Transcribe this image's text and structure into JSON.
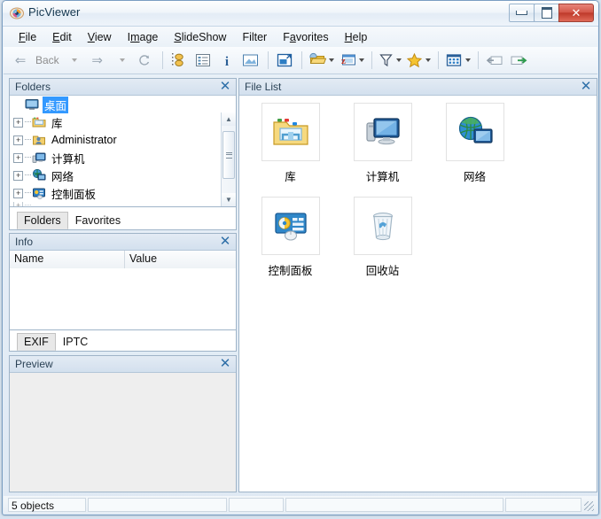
{
  "window": {
    "title": "PicViewer",
    "app_icon": "eye-icon",
    "buttons": {
      "minimize": "minimize-icon",
      "maximize": "maximize-icon",
      "close": "✕"
    }
  },
  "menu": {
    "items": [
      {
        "label": "File",
        "accel": "F"
      },
      {
        "label": "Edit",
        "accel": "E"
      },
      {
        "label": "View",
        "accel": "V"
      },
      {
        "label": "Image",
        "accel": "I"
      },
      {
        "label": "SlideShow",
        "accel": "S"
      },
      {
        "label": "Filter",
        "accel": "F"
      },
      {
        "label": "Favorites",
        "accel": "a"
      },
      {
        "label": "Help",
        "accel": "H"
      }
    ]
  },
  "toolbar": {
    "back_label": "Back",
    "items": [
      {
        "name": "back-button",
        "icon": "arrow-left-icon"
      },
      {
        "name": "back-dropdown",
        "icon": "chevron-down-icon"
      },
      {
        "name": "forward-button",
        "icon": "arrow-right-icon"
      },
      {
        "name": "forward-dropdown",
        "icon": "chevron-down-icon"
      },
      {
        "name": "refresh-button",
        "icon": "refresh-icon"
      },
      {
        "name": "thumbnails-view-button",
        "icon": "thumbnails-icon"
      },
      {
        "name": "details-view-button",
        "icon": "list-icon"
      },
      {
        "name": "info-button",
        "icon": "info-icon"
      },
      {
        "name": "preview-button",
        "icon": "preview-icon"
      },
      {
        "name": "fullscreen-button",
        "icon": "fullscreen-icon"
      },
      {
        "name": "open-folder-button",
        "icon": "folder-icon"
      },
      {
        "name": "slideshow-button",
        "icon": "slideshow-icon"
      },
      {
        "name": "filter-button",
        "icon": "funnel-icon"
      },
      {
        "name": "favorites-button",
        "icon": "star-icon"
      },
      {
        "name": "view-mode-button",
        "icon": "grid-icon"
      },
      {
        "name": "import-button",
        "icon": "import-arrow-icon"
      },
      {
        "name": "export-button",
        "icon": "export-arrow-icon"
      }
    ]
  },
  "folders_panel": {
    "title": "Folders",
    "close": "✕",
    "tree": [
      {
        "label": "桌面",
        "icon": "desktop-icon",
        "expandable": false,
        "selected": true
      },
      {
        "label": "库",
        "icon": "library-icon",
        "expandable": true,
        "selected": false
      },
      {
        "label": "Administrator",
        "icon": "user-icon",
        "expandable": true,
        "selected": false
      },
      {
        "label": "计算机",
        "icon": "computer-icon",
        "expandable": true,
        "selected": false
      },
      {
        "label": "网络",
        "icon": "network-icon",
        "expandable": true,
        "selected": false
      },
      {
        "label": "控制面板",
        "icon": "control-panel-icon",
        "expandable": true,
        "selected": false
      }
    ],
    "expander_plus": "+",
    "tabs": [
      {
        "label": "Folders",
        "active": true
      },
      {
        "label": "Favorites",
        "active": false
      }
    ]
  },
  "info_panel": {
    "title": "Info",
    "close": "✕",
    "columns": [
      "Name",
      "Value"
    ],
    "rows": [],
    "tabs": [
      {
        "label": "EXIF",
        "active": true
      },
      {
        "label": "IPTC",
        "active": false
      }
    ]
  },
  "preview_panel": {
    "title": "Preview",
    "close": "✕"
  },
  "file_list": {
    "title": "File List",
    "close": "✕",
    "items": [
      {
        "name": "库",
        "icon": "library-folder-icon"
      },
      {
        "name": "计算机",
        "icon": "computer-icon"
      },
      {
        "name": "网络",
        "icon": "network-globe-icon"
      },
      {
        "name": "控制面板",
        "icon": "control-panel-icon"
      },
      {
        "name": "回收站",
        "icon": "recycle-bin-icon"
      }
    ]
  },
  "status_bar": {
    "cells": [
      "5 objects",
      "",
      "",
      "",
      ""
    ],
    "grip": "resize-grip-icon"
  },
  "colors": {
    "accent": "#3399ff",
    "panel_caption": "#d3e0ee",
    "frame_border": "#7a9ec2",
    "close_button": "#bf3a2b"
  }
}
